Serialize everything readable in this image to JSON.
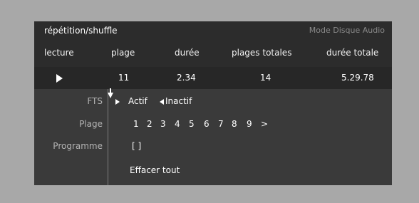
{
  "header": {
    "title": "répétition/shuffle",
    "mode": "Mode Disque Audio"
  },
  "columns": {
    "lecture": "lecture",
    "plage": "plage",
    "duree": "durée",
    "plages_totales": "plages totales",
    "duree_totale": "durée totale"
  },
  "status": {
    "lecture_icon": "play-icon",
    "plage": "11",
    "duree": "2.34",
    "plages_totales": "14",
    "duree_totale": "5.29.78"
  },
  "settings": {
    "fts": {
      "label": "FTS",
      "options": [
        "Actif",
        "Inactif"
      ],
      "selected": "Actif"
    },
    "plage": {
      "label": "Plage",
      "tracks": [
        "1",
        "2",
        "3",
        "4",
        "5",
        "6",
        "7",
        "8",
        "9"
      ],
      "more": ">"
    },
    "programme": {
      "label": "Programme",
      "value": "[ ]",
      "clear_label": "Effacer tout"
    }
  }
}
